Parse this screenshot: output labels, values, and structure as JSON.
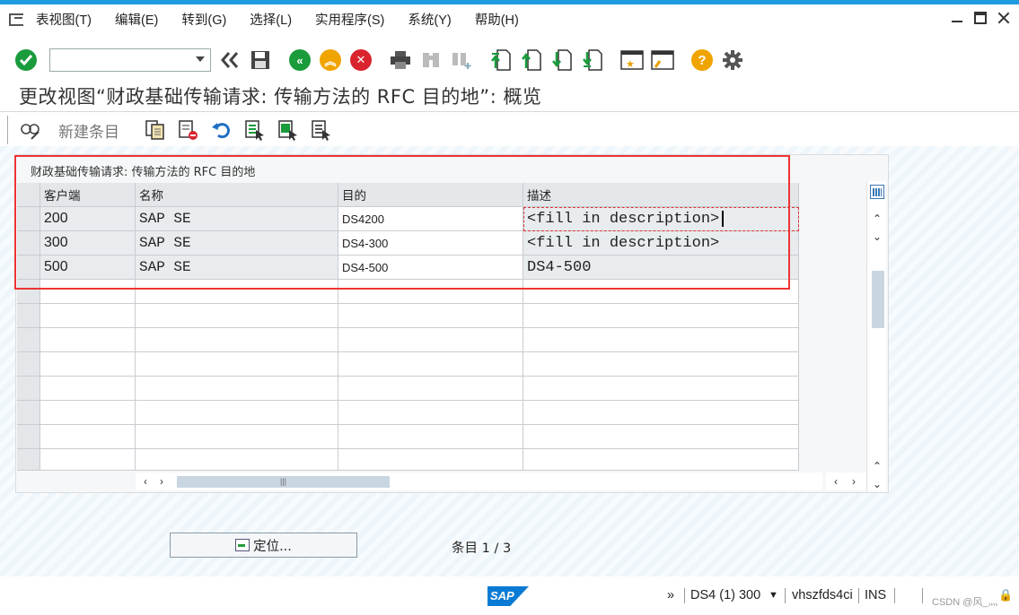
{
  "menu": {
    "items": [
      "表视图(T)",
      "编辑(E)",
      "转到(G)",
      "选择(L)",
      "实用程序(S)",
      "系统(Y)",
      "帮助(H)"
    ]
  },
  "toolbar": {
    "command_value": "",
    "icons": [
      "enter-icon",
      "back-double-icon",
      "save-icon",
      "back-icon",
      "exit-icon",
      "cancel-icon",
      "print-icon",
      "find-icon",
      "find-next-icon",
      "first-page-icon",
      "prev-page-icon",
      "next-page-icon",
      "last-page-icon",
      "create-session-icon",
      "shortcut-icon",
      "help-icon",
      "customize-icon"
    ]
  },
  "title": "更改视图“财政基础传输请求: 传输方法的 RFC 目的地”: 概览",
  "app_toolbar": {
    "new_entries": "新建条目",
    "icons": [
      "display-change-icon",
      "copy-icon",
      "delete-icon",
      "undo-icon",
      "select-all-icon",
      "select-block-icon",
      "deselect-all-icon"
    ]
  },
  "table": {
    "title": "财政基础传输请求: 传输方法的 RFC 目的地",
    "columns": [
      "客户端",
      "名称",
      "目的",
      "描述"
    ],
    "rows": [
      {
        "client": "200",
        "name": "SAP SE",
        "dest": "DS4200",
        "desc": "<fill in description>"
      },
      {
        "client": "300",
        "name": "SAP SE",
        "dest": "DS4-300",
        "desc": "<fill in description>"
      },
      {
        "client": "500",
        "name": "SAP SE",
        "dest": "DS4-500",
        "desc": "DS4-500"
      }
    ],
    "empty_rows": 8
  },
  "bottom": {
    "position_button": "定位...",
    "entry_info": "条目 1 / 3"
  },
  "statusbar": {
    "system": "DS4 (1) 300",
    "server": "vhszfds4ci",
    "mode": "INS",
    "expand": "»",
    "watermark": "CSDN @风_灬"
  },
  "colors": {
    "accent": "#1e9be0",
    "annotation": "#e33333",
    "ok_green": "#1a9b3c"
  }
}
